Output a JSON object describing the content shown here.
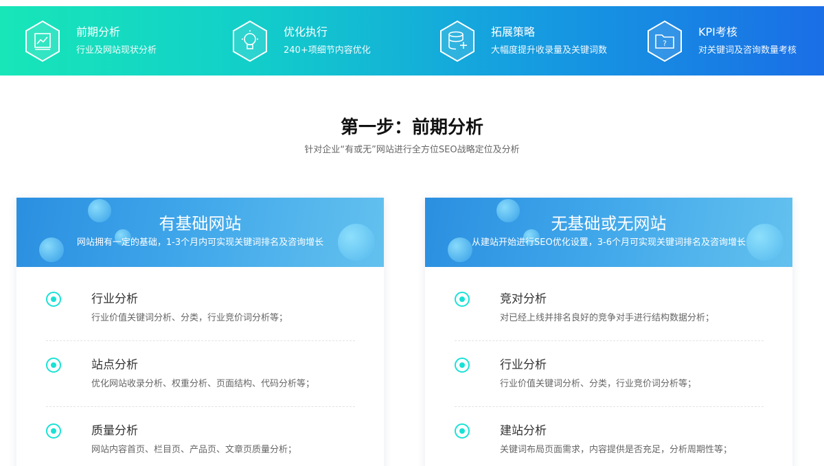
{
  "steps": [
    {
      "title": "前期分析",
      "sub": "行业及网站现状分析",
      "icon": "chart-icon"
    },
    {
      "title": "优化执行",
      "sub": "240+项细节内容优化",
      "icon": "lightbulb-icon"
    },
    {
      "title": "拓展策略",
      "sub": "大幅度提升收录量及关键词数",
      "icon": "database-plus-icon"
    },
    {
      "title": "KPI考核",
      "sub": "对关键词及咨询数量考核",
      "icon": "question-folder-icon"
    }
  ],
  "section": {
    "title": "第一步：前期分析",
    "sub": "针对企业“有或无”网站进行全方位SEO战略定位及分析"
  },
  "cards": [
    {
      "title": "有基础网站",
      "sub": "网站拥有一定的基础，1-3个月内可实现关键词排名及咨询增长",
      "items": [
        {
          "title": "行业分析",
          "desc": "行业价值关键词分析、分类，行业竞价词分析等；"
        },
        {
          "title": "站点分析",
          "desc": "优化网站收录分析、权重分析、页面结构、代码分析等；"
        },
        {
          "title": "质量分析",
          "desc": "网站内容首页、栏目页、产品页、文章页质量分析；"
        }
      ]
    },
    {
      "title": "无基础或无网站",
      "sub": "从建站开始进行SEO优化设置，3-6个月可实现关键词排名及咨询增长",
      "items": [
        {
          "title": "竞对分析",
          "desc": "对已经上线并排名良好的竞争对手进行结构数据分析；"
        },
        {
          "title": "行业分析",
          "desc": "行业价值关键词分析、分类，行业竞价词分析等；"
        },
        {
          "title": "建站分析",
          "desc": "关键词布局页面需求，内容提供是否充足，分析周期性等；"
        }
      ]
    }
  ],
  "colors": {
    "banner_start": "#18e6b8",
    "banner_end": "#1a6ee6",
    "accent": "#18e2d6",
    "card_head": "#3fa6ea"
  }
}
